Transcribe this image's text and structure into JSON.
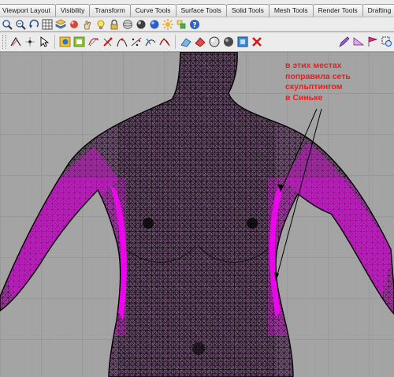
{
  "tabs": [
    "Viewport Layout",
    "Visibility",
    "Transform",
    "Curve Tools",
    "Surface Tools",
    "Solid Tools",
    "Mesh Tools",
    "Render Tools",
    "Drafting"
  ],
  "annotation": {
    "lines": [
      "в этих местах",
      "поправила сеть",
      "скульптингом",
      "в Синьке"
    ]
  },
  "colors": {
    "annotation": "#e3201e",
    "mesh_highlight": "#ff00ff",
    "viewport_bg": "#a4a4a4",
    "grid_major": "#9a9a9a"
  },
  "icons": {
    "row1": [
      "zoom-extents-icon",
      "pan-icon",
      "rotate-view-icon",
      "grid-icon",
      "layer-icon",
      "material-icon",
      "hand-icon",
      "light-bulb-icon",
      "lock-icon",
      "sphere-gray-icon",
      "sphere-shaded-icon",
      "sphere-blue-icon",
      "sun-icon",
      "paint-icon",
      "help-icon"
    ],
    "row2": [
      "curve-icon",
      "point-icon",
      "select-icon",
      "sphere-icon",
      "box-icon",
      "mesh-icon",
      "delete-icon",
      "analysis-icon"
    ]
  }
}
